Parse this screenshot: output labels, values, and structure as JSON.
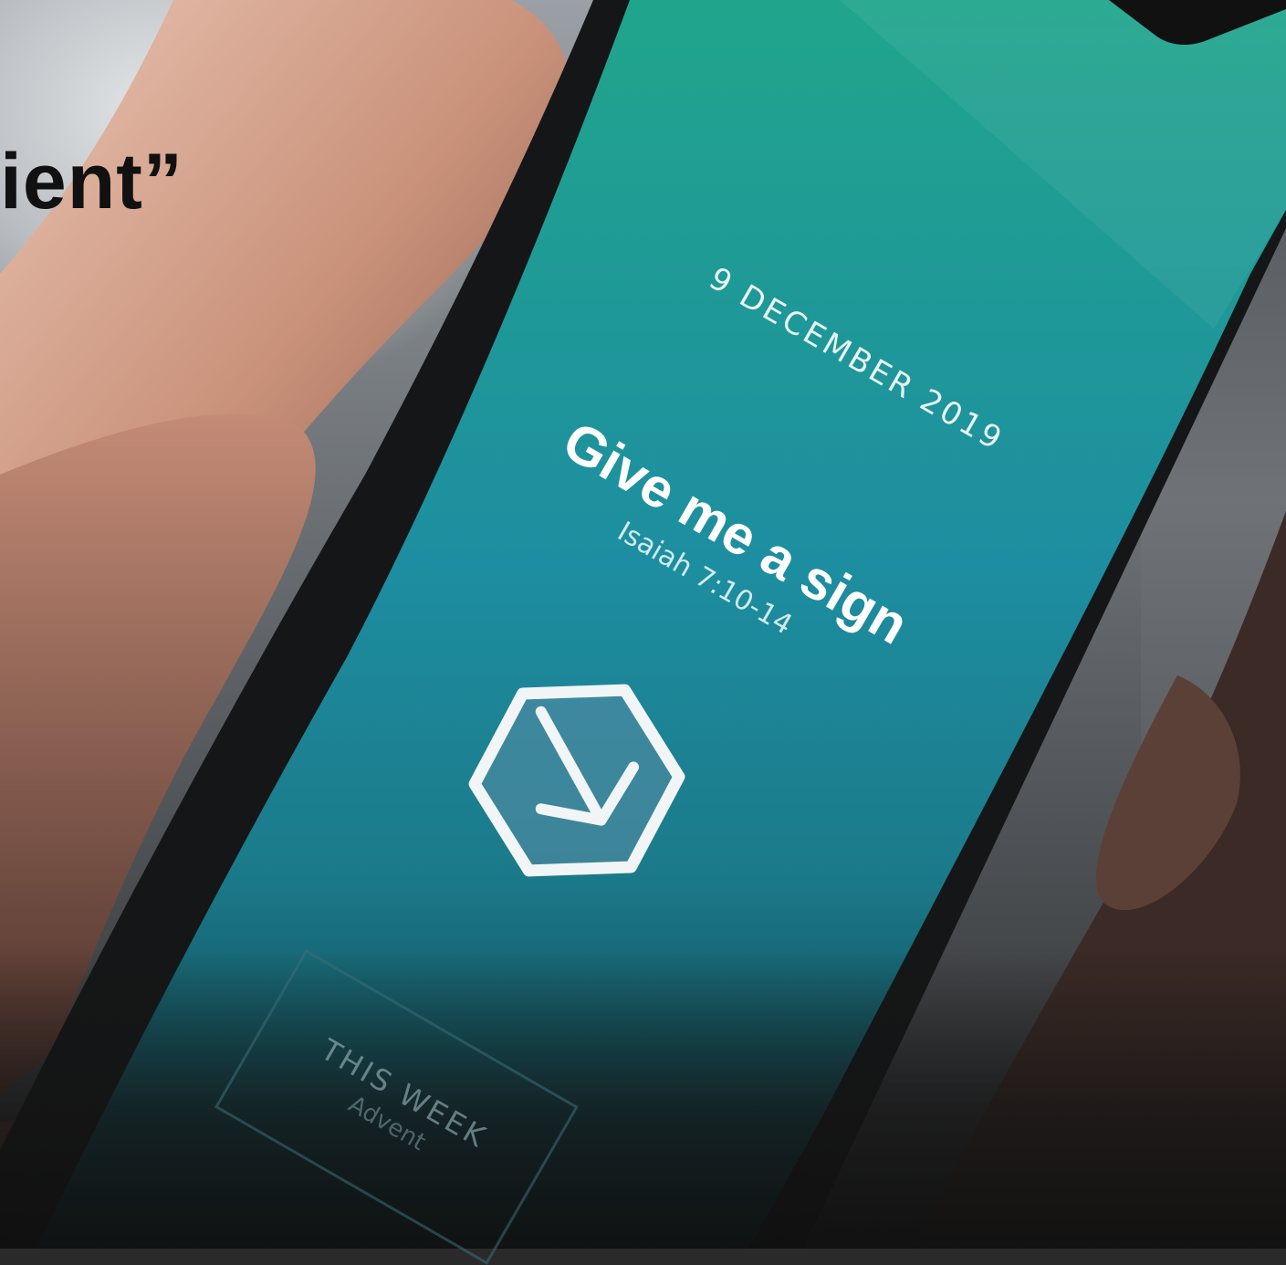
{
  "headline": {
    "text": "ient”"
  },
  "phone": {
    "date": "9 DECEMBER 2019",
    "title": "Give me a sign",
    "reference": "Isaiah 7:10-14",
    "week_card": {
      "heading": "THIS WEEK",
      "subheading": "Advent"
    },
    "icon": "hexagon-arrow-icon"
  },
  "colors": {
    "screen_top": "#1f9e8a",
    "screen_mid": "#1d8fa3",
    "screen_bottom": "#1b6f7f",
    "phone_frame": "#161718",
    "skin": "#d9ad98"
  }
}
